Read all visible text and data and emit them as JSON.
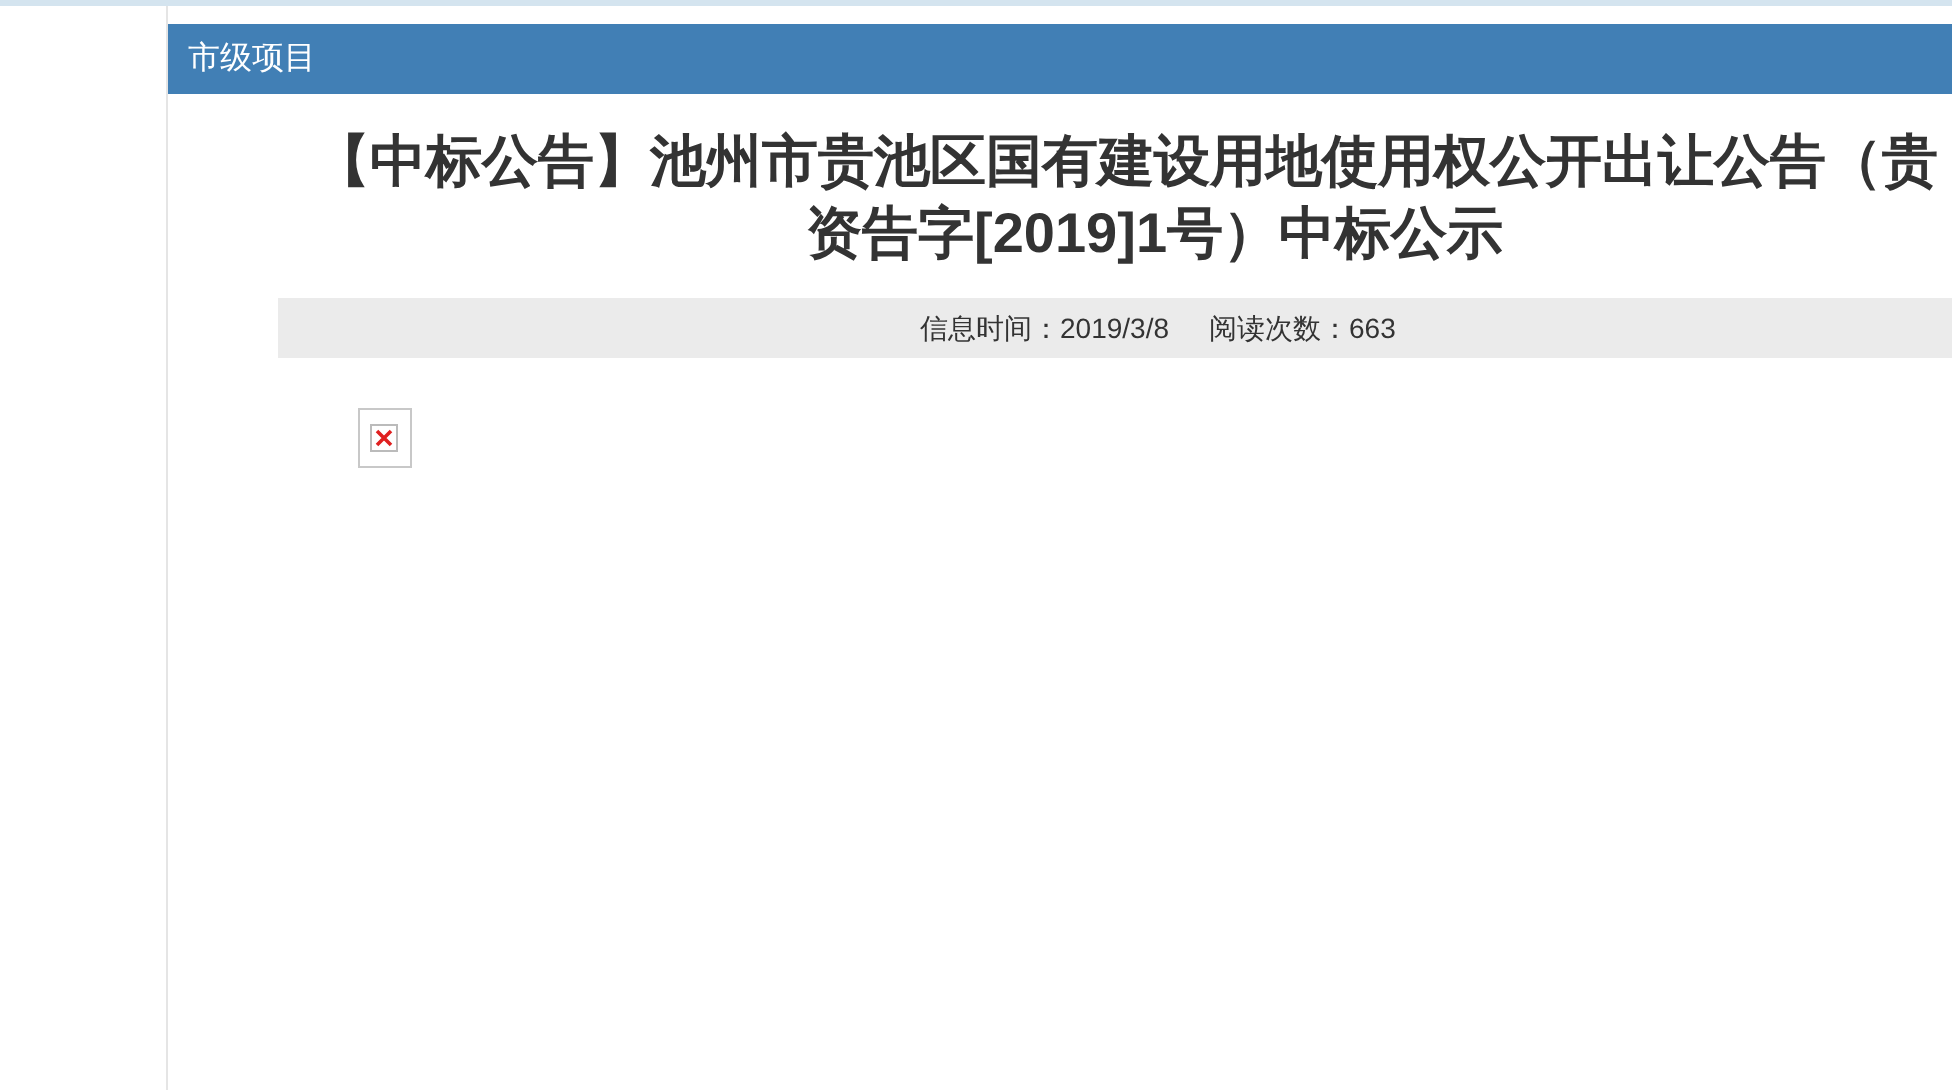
{
  "section_header": {
    "title": "市级项目"
  },
  "article": {
    "title_lines": [
      "【中标公告】池州市贵池区国有建设用地使用权公开出让公告（贵",
      "资告字[2019]1号）中标公示"
    ],
    "meta": [
      {
        "label": "信息时间：",
        "value": "2019/3/8"
      },
      {
        "label": "阅读次数：",
        "value": "663"
      }
    ],
    "content": {
      "kind": "broken-image"
    }
  }
}
